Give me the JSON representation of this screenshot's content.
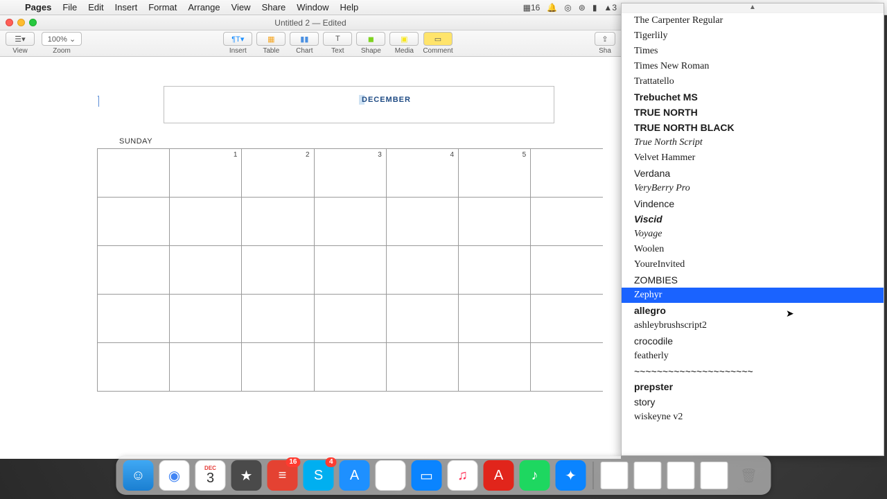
{
  "menubar": {
    "app": "Pages",
    "items": [
      "File",
      "Edit",
      "Insert",
      "Format",
      "Arrange",
      "View",
      "Share",
      "Window",
      "Help"
    ],
    "right": {
      "badge": "16",
      "adobe": "3"
    }
  },
  "window": {
    "title": "Untitled 2  —  Edited",
    "toolbar": {
      "view": "View",
      "zoom_label": "Zoom",
      "zoom_value": "100% ⌄",
      "insert": "Insert",
      "table": "Table",
      "chart": "Chart",
      "text": "Text",
      "shape": "Shape",
      "media": "Media",
      "comment": "Comment",
      "share": "Sha"
    }
  },
  "document": {
    "month": "DECEMBER",
    "day_label": "SUNDAY",
    "row1": [
      "",
      "1",
      "2",
      "3",
      "4",
      "5"
    ]
  },
  "fontpanel": {
    "scroll": "▲",
    "fonts": [
      {
        "label": "The Carpenter Regular",
        "cls": "f-script f-small"
      },
      {
        "label": "Tigerlily",
        "cls": "f-serif"
      },
      {
        "label": "Times",
        "cls": "f-serif"
      },
      {
        "label": "Times New Roman",
        "cls": "f-serif"
      },
      {
        "label": "Trattatello",
        "cls": "f-script f-small"
      },
      {
        "label": "Trebuchet MS",
        "cls": "f-sans f-bold"
      },
      {
        "label": "TRUE NORTH",
        "cls": "f-bold"
      },
      {
        "label": "TRUE NORTH BLACK",
        "cls": "f-bold"
      },
      {
        "label": "True North Script",
        "cls": "f-script f-small f-italic"
      },
      {
        "label": "Velvet Hammer",
        "cls": "f-script f-small"
      },
      {
        "label": "Verdana",
        "cls": "f-sans"
      },
      {
        "label": "VeryBerry Pro",
        "cls": "f-script f-italic f-small"
      },
      {
        "label": "Vindence",
        "cls": "f-small"
      },
      {
        "label": "Viscid",
        "cls": "f-bold f-italic"
      },
      {
        "label": "Voyage",
        "cls": "f-script f-italic"
      },
      {
        "label": "Woolen",
        "cls": "f-script f-small"
      },
      {
        "label": "YoureInvited",
        "cls": "f-script"
      },
      {
        "label": "ZOMBIES",
        "cls": "f-small"
      },
      {
        "label": "Zephyr",
        "cls": "f-script f-small",
        "selected": true
      },
      {
        "label": "allegro",
        "cls": "f-small f-bold"
      },
      {
        "label": "ashleybrushscript2",
        "cls": "f-script f-small"
      },
      {
        "label": "crocodile",
        "cls": "f-small"
      },
      {
        "label": "featherly",
        "cls": "f-script f-small"
      },
      {
        "label": "~~~~~~~~~~~~~~~~~~~~~",
        "cls": "f-small"
      },
      {
        "label": "prepster",
        "cls": "f-small f-bold"
      },
      {
        "label": "story",
        "cls": "f-small"
      },
      {
        "label": "wiskeyne v2",
        "cls": "f-script f-small"
      }
    ]
  },
  "dock": {
    "todoist_badge": "16",
    "skype_badge": "4",
    "cal_day": "3",
    "cal_mon": "DEC"
  }
}
